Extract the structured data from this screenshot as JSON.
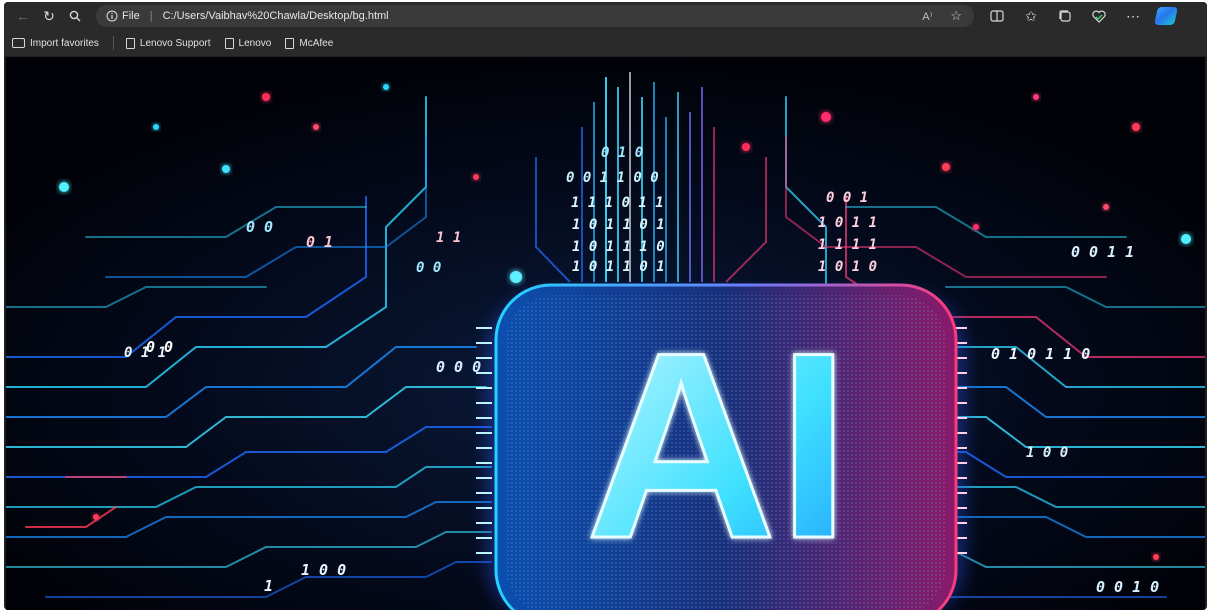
{
  "toolbar": {
    "address": {
      "scheme_label": "File",
      "url": "C:/Users/Vaibhav%20Chawla/Desktop/bg.html",
      "read_aloud_label": "A⁾"
    }
  },
  "bookmarks": {
    "items": [
      {
        "label": "Import favorites",
        "icon": "folder-import-icon"
      },
      {
        "label": "Lenovo Support",
        "icon": "page-icon"
      },
      {
        "label": "Lenovo",
        "icon": "page-icon"
      },
      {
        "label": "McAfee",
        "icon": "page-icon"
      }
    ]
  },
  "page": {
    "hero_text": "AI",
    "binary_rows": [
      "0 1 0",
      "0 0 1 1 0 0",
      "1 1 1 0 1 1",
      "1 0 1 1 0 1",
      "1 0 1 1 1 0",
      "1 0 1 1 0 1",
      "0 0 1",
      "1 0 1 1",
      "1 1 1 1",
      "1 0 1 0",
      "0 0 1 1",
      "0 1 0 1 1 0",
      "0 0 1 0",
      "0 0",
      "0 1",
      "1 1",
      "0 0",
      "0 0 0",
      "1 0 0",
      "1",
      "0 0",
      "0 1 1",
      "1 0 0"
    ]
  },
  "colors": {
    "cyan": "#2ee6ff",
    "blue": "#1b6bff",
    "magenta": "#ff2e7a",
    "red": "#ff3040"
  }
}
